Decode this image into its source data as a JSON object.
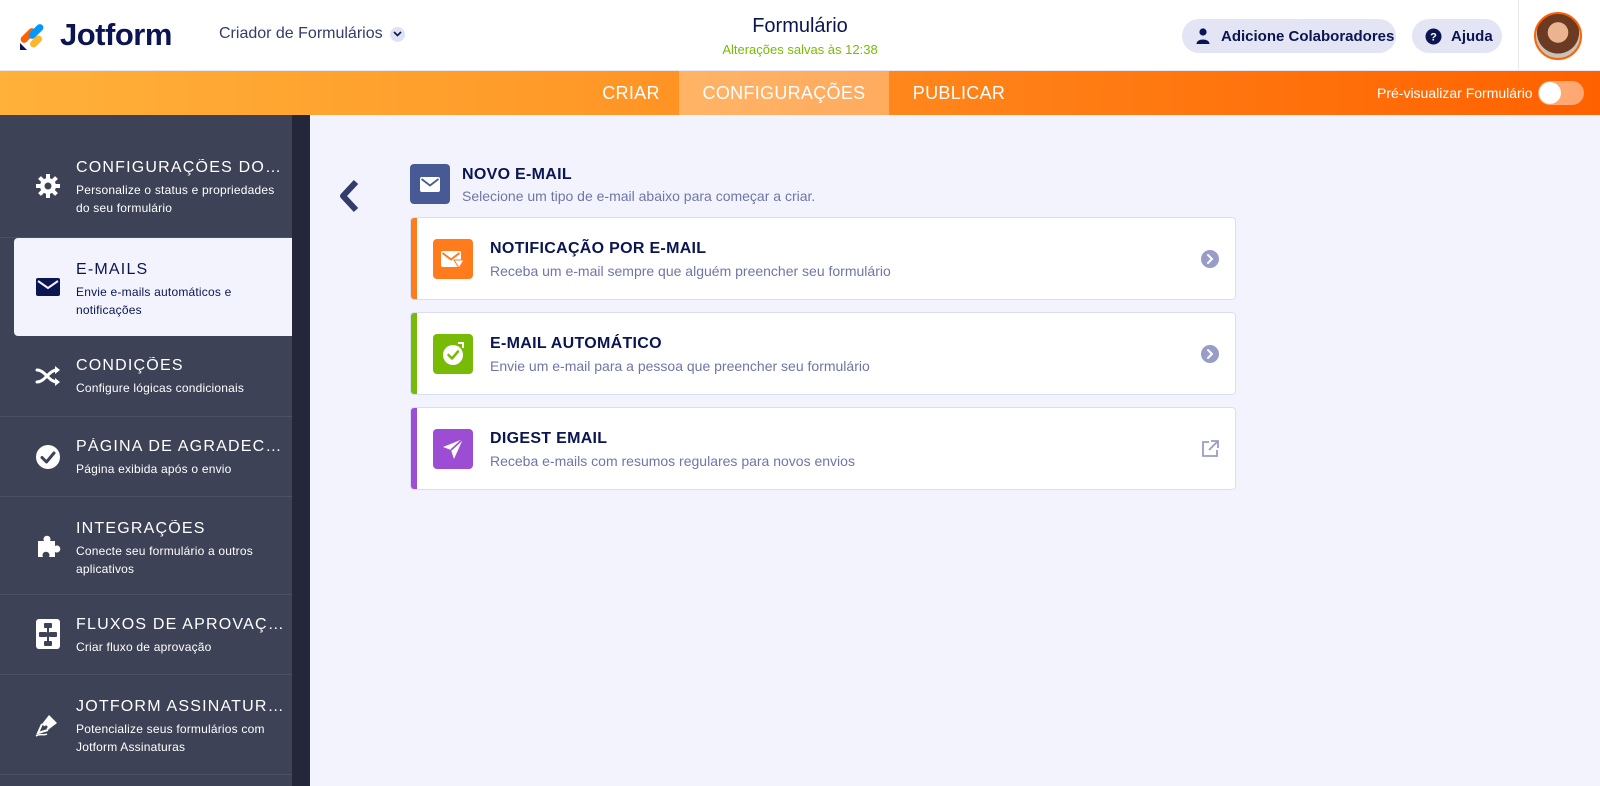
{
  "header": {
    "logo_text": "Jotform",
    "builder_label": "Criador de Formulários",
    "form_title": "Formulário",
    "save_status": "Alterações salvas às 12:38",
    "add_collaborators": "Adicione Colaboradores",
    "help": "Ajuda"
  },
  "nav": {
    "tabs": [
      {
        "label": "CRIAR"
      },
      {
        "label": "CONFIGURAÇÕES"
      },
      {
        "label": "PUBLICAR"
      }
    ],
    "preview_label": "Pré-visualizar Formulário"
  },
  "sidebar": {
    "items": [
      {
        "title": "CONFIGURAÇÕES DO FORMULÁRIO",
        "subtitle": "Personalize o status e propriedades do seu formulário",
        "icon": "gear-icon"
      },
      {
        "title": "E-MAILS",
        "subtitle": "Envie e-mails automáticos e notificações",
        "icon": "envelope-icon"
      },
      {
        "title": "CONDIÇÕES",
        "subtitle": "Configure lógicas condicionais",
        "icon": "shuffle-icon"
      },
      {
        "title": "PÁGINA DE AGRADECIMENTO",
        "subtitle": "Página exibida após o envio",
        "icon": "check-circle-icon"
      },
      {
        "title": "INTEGRAÇÕES",
        "subtitle": "Conecte seu formulário a outros aplicativos",
        "icon": "puzzle-icon"
      },
      {
        "title": "FLUXOS DE APROVAÇÃO",
        "subtitle": "Criar fluxo de aprovação",
        "icon": "flow-icon"
      },
      {
        "title": "JOTFORM ASSINATURAS",
        "subtitle": "Potencialize seus formulários com Jotform Assinaturas",
        "icon": "pen-icon"
      }
    ]
  },
  "main": {
    "new_email_title": "NOVO E-MAIL",
    "new_email_subtitle": "Selecione um tipo de e-mail abaixo para começar a criar.",
    "cards": [
      {
        "title": "NOTIFICAÇÃO POR E-MAIL",
        "subtitle": "Receba um e-mail sempre que alguém preencher seu formulário",
        "color": "#ff7b1c",
        "icon": "notification-mail-icon",
        "action": "chevron-right-icon"
      },
      {
        "title": "E-MAIL AUTOMÁTICO",
        "subtitle": "Envie um e-mail para a pessoa que preencher seu formulário",
        "color": "#78bb07",
        "icon": "autoresponder-check-icon",
        "action": "chevron-right-icon"
      },
      {
        "title": "DIGEST EMAIL",
        "subtitle": "Receba e-mails com resumos regulares para novos envios",
        "color": "#9c4dd3",
        "icon": "paper-plane-icon",
        "action": "external-link-icon"
      }
    ]
  },
  "colors": {
    "navy": "#0a1551",
    "orange": "#ff6100",
    "green": "#78bb07",
    "purple": "#9c4dd3",
    "sidebar": "#3e4256"
  }
}
